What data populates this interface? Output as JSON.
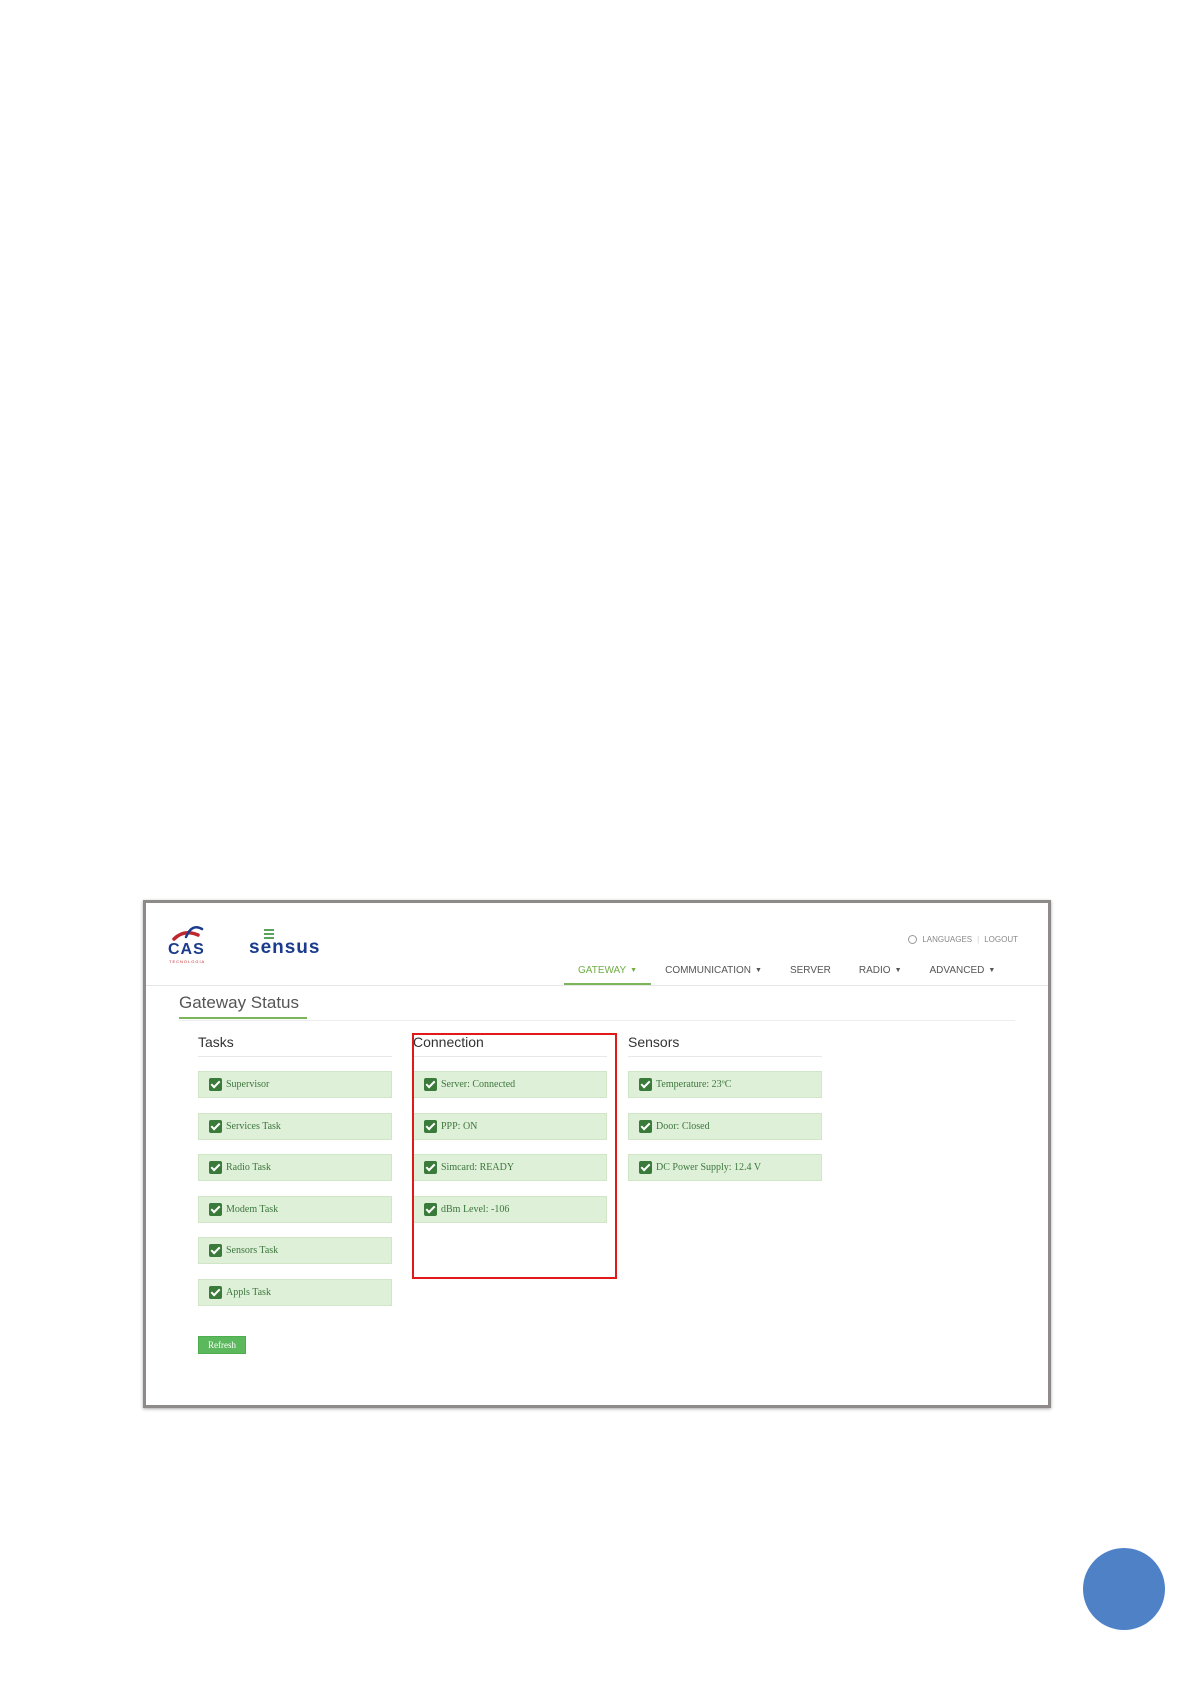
{
  "brand": {
    "cas_logo": "CAS",
    "cas_sub": "TECNOLOGIA",
    "sensus_logo": "sensus"
  },
  "header": {
    "languages": "LANGUAGES",
    "logout": "LOGOUT"
  },
  "nav": {
    "gateway": "GATEWAY",
    "communication": "COMMUNICATION",
    "server": "SERVER",
    "radio": "RADIO",
    "advanced": "ADVANCED"
  },
  "page": {
    "title": "Gateway Status"
  },
  "tasks": {
    "title": "Tasks",
    "items": [
      "Supervisor",
      "Services Task",
      "Radio Task",
      "Modem Task",
      "Sensors Task",
      "Appls Task"
    ]
  },
  "connection": {
    "title": "Connection",
    "items": [
      "Server: Connected",
      "PPP: ON",
      "Simcard: READY",
      "dBm Level: -106"
    ]
  },
  "sensors": {
    "title": "Sensors",
    "items": [
      "Temperature: 23ºC",
      "Door: Closed",
      "DC Power Supply: 12.4 V"
    ]
  },
  "actions": {
    "refresh": "Refresh"
  },
  "colors": {
    "accent": "#7bb55a",
    "success_bg": "#dff0d8",
    "success_text": "#3c763d",
    "highlight": "#e01919",
    "page_circle": "#4f81c7"
  }
}
